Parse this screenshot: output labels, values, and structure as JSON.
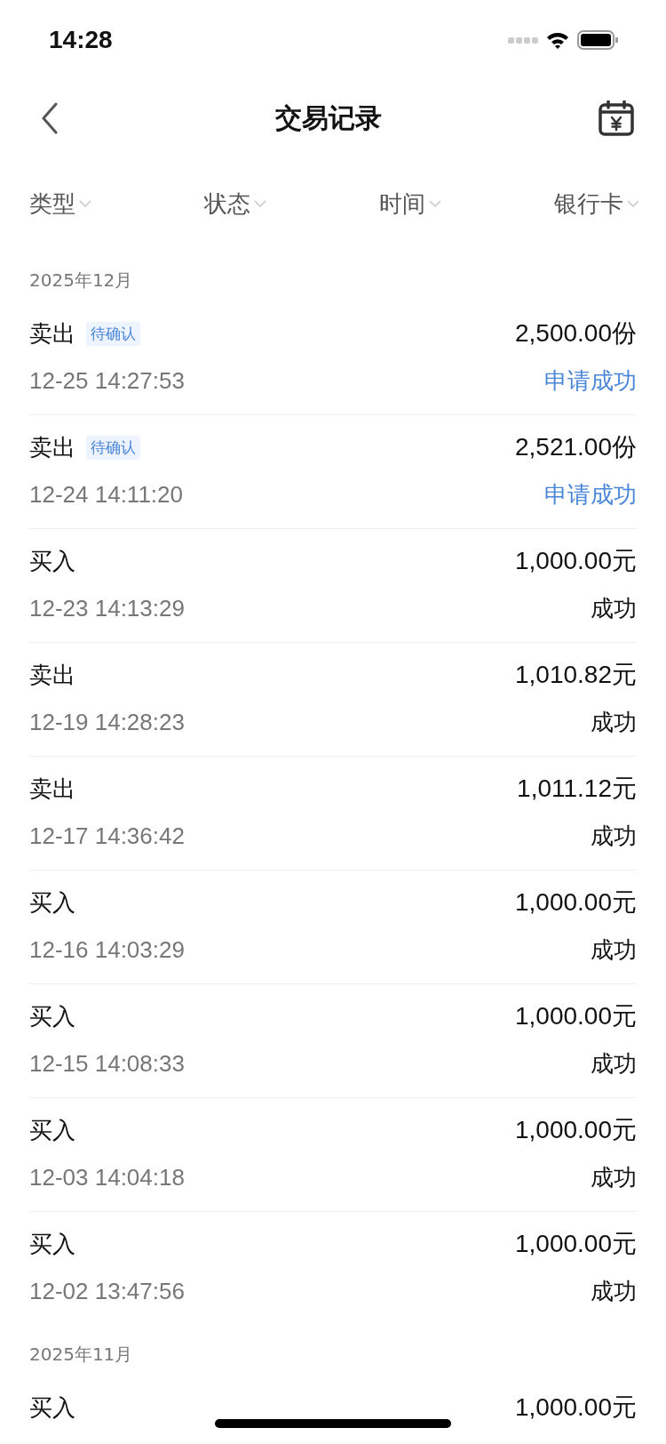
{
  "status_bar": {
    "time": "14:28"
  },
  "nav": {
    "title": "交易记录"
  },
  "filters": [
    {
      "label": "类型"
    },
    {
      "label": "状态"
    },
    {
      "label": "时间"
    },
    {
      "label": "银行卡"
    }
  ],
  "sections": [
    {
      "month": "2025年12月",
      "rows": [
        {
          "type": "卖出",
          "badge": "待确认",
          "amount": "2,500.00份",
          "time": "12-25 14:27:53",
          "status": "申请成功",
          "pending": true
        },
        {
          "type": "卖出",
          "badge": "待确认",
          "amount": "2,521.00份",
          "time": "12-24 14:11:20",
          "status": "申请成功",
          "pending": true
        },
        {
          "type": "买入",
          "amount": "1,000.00元",
          "time": "12-23 14:13:29",
          "status": "成功",
          "pending": false
        },
        {
          "type": "卖出",
          "amount": "1,010.82元",
          "time": "12-19 14:28:23",
          "status": "成功",
          "pending": false
        },
        {
          "type": "卖出",
          "amount": "1,011.12元",
          "time": "12-17 14:36:42",
          "status": "成功",
          "pending": false
        },
        {
          "type": "买入",
          "amount": "1,000.00元",
          "time": "12-16 14:03:29",
          "status": "成功",
          "pending": false
        },
        {
          "type": "买入",
          "amount": "1,000.00元",
          "time": "12-15 14:08:33",
          "status": "成功",
          "pending": false
        },
        {
          "type": "买入",
          "amount": "1,000.00元",
          "time": "12-03 14:04:18",
          "status": "成功",
          "pending": false
        },
        {
          "type": "买入",
          "amount": "1,000.00元",
          "time": "12-02 13:47:56",
          "status": "成功",
          "pending": false
        }
      ]
    },
    {
      "month": "2025年11月",
      "rows": [
        {
          "type": "买入",
          "amount": "1,000.00元"
        }
      ]
    }
  ]
}
